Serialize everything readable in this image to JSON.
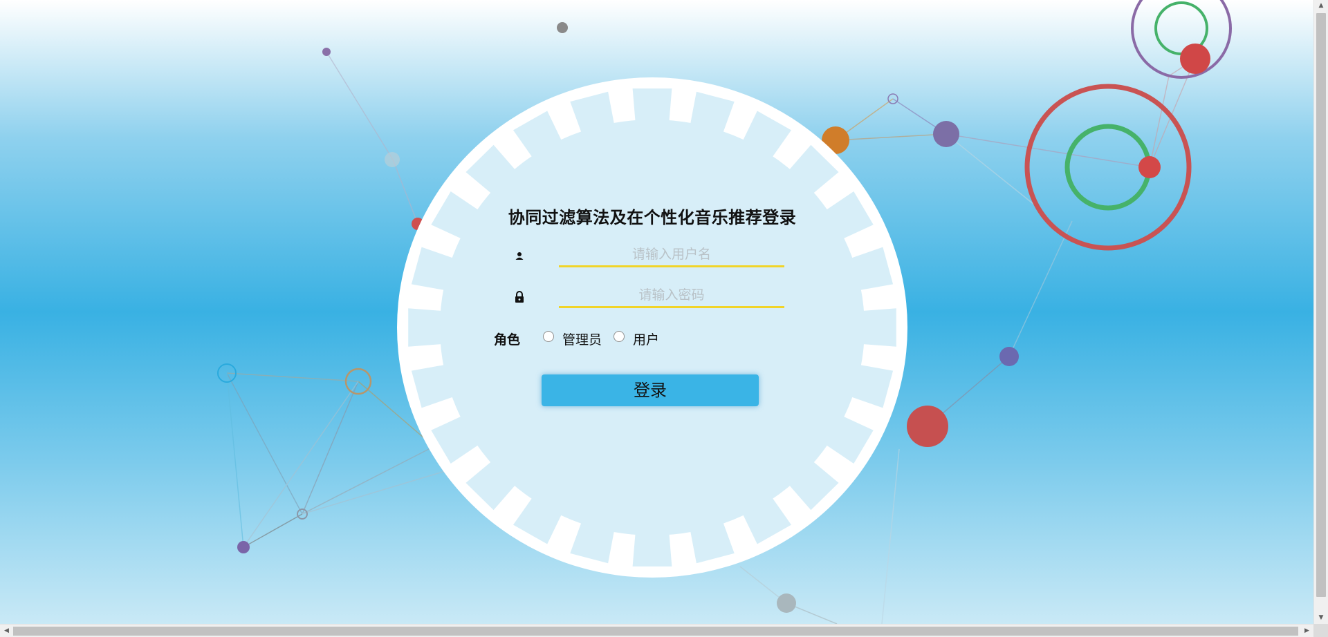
{
  "login": {
    "title": "协同过滤算法及在个性化音乐推荐登录",
    "username": {
      "placeholder": "请输入用户名",
      "value": ""
    },
    "password": {
      "placeholder": "请输入密码",
      "value": ""
    },
    "role": {
      "label": "角色",
      "options": [
        "管理员",
        "用户"
      ],
      "selected": null
    },
    "submit_label": "登录"
  },
  "icons": {
    "username": "user-icon",
    "password": "lock-icon"
  },
  "colors": {
    "button": "#3ab4e6",
    "input_underline": "#f1d429",
    "panel_face": "#d7eef8"
  }
}
